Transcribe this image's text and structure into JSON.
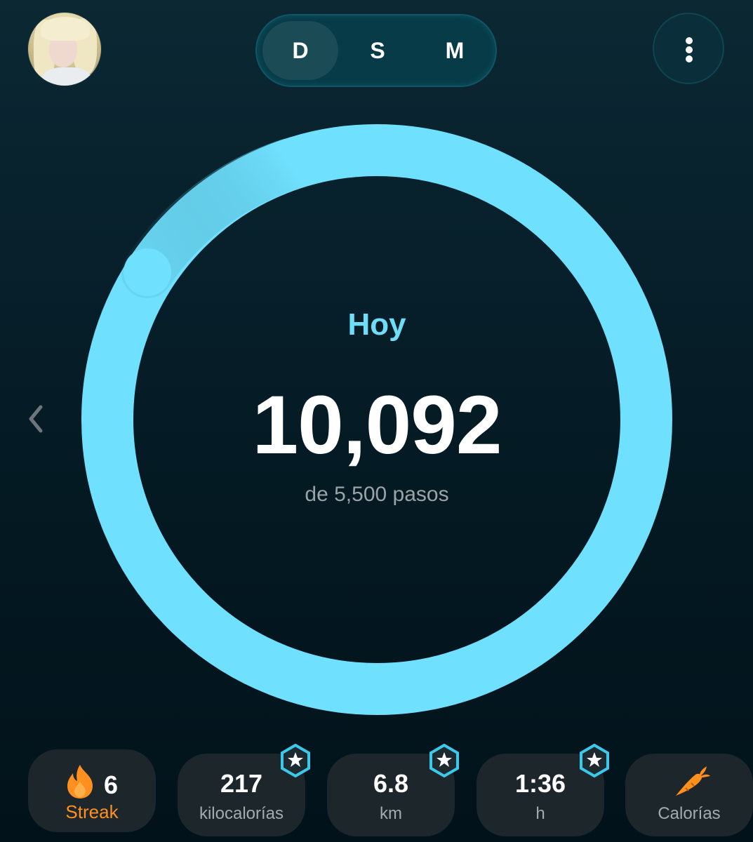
{
  "header": {
    "avatar_icon": "user-avatar",
    "period_tabs": [
      {
        "label": "D",
        "active": true
      },
      {
        "label": "S",
        "active": false
      },
      {
        "label": "M",
        "active": false
      }
    ],
    "menu_icon": "more-vertical-icon"
  },
  "progress": {
    "label": "Hoy",
    "steps": "10,092",
    "goal_text": "de 5,500 pasos",
    "ring_color": "#6fe0fd",
    "label_color": "#6fdcf8"
  },
  "nav": {
    "previous_icon": "chevron-left-icon"
  },
  "stats": [
    {
      "id": "streak",
      "value": "6",
      "label": "Streak",
      "icon": "flame-icon",
      "accent": "#ff8f1f"
    },
    {
      "id": "calories",
      "value": "217",
      "label": "kilocalorías",
      "icon": "star-badge-icon"
    },
    {
      "id": "distance",
      "value": "6.8",
      "label": "km",
      "icon": "star-badge-icon"
    },
    {
      "id": "time",
      "value": "1:36",
      "label": "h",
      "icon": "star-badge-icon"
    },
    {
      "id": "food",
      "value": "",
      "label": "Calorías",
      "icon": "carrot-icon"
    }
  ]
}
